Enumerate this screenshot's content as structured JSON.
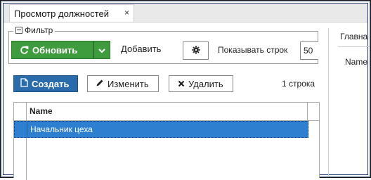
{
  "tab": {
    "title": "Просмотр должностей",
    "close": "×"
  },
  "filter": {
    "legend": "Фильтр",
    "refresh_label": "Обновить",
    "add_label": "Добавить",
    "rows_label": "Показывать строк",
    "rows_value": "50"
  },
  "actions": {
    "create_label": "Создать",
    "edit_label": "Изменить",
    "delete_label": "Удалить",
    "row_count": "1 строка"
  },
  "grid": {
    "columns": [
      "Name"
    ],
    "rows": [
      {
        "name": "Начальник цеха",
        "selected": true
      }
    ]
  },
  "right_panel": {
    "tab_label": "Главна",
    "field_label": "Name"
  },
  "colors": {
    "refresh": "#3e9c3e",
    "create": "#2a6bab",
    "selection": "#2f7fd0"
  }
}
